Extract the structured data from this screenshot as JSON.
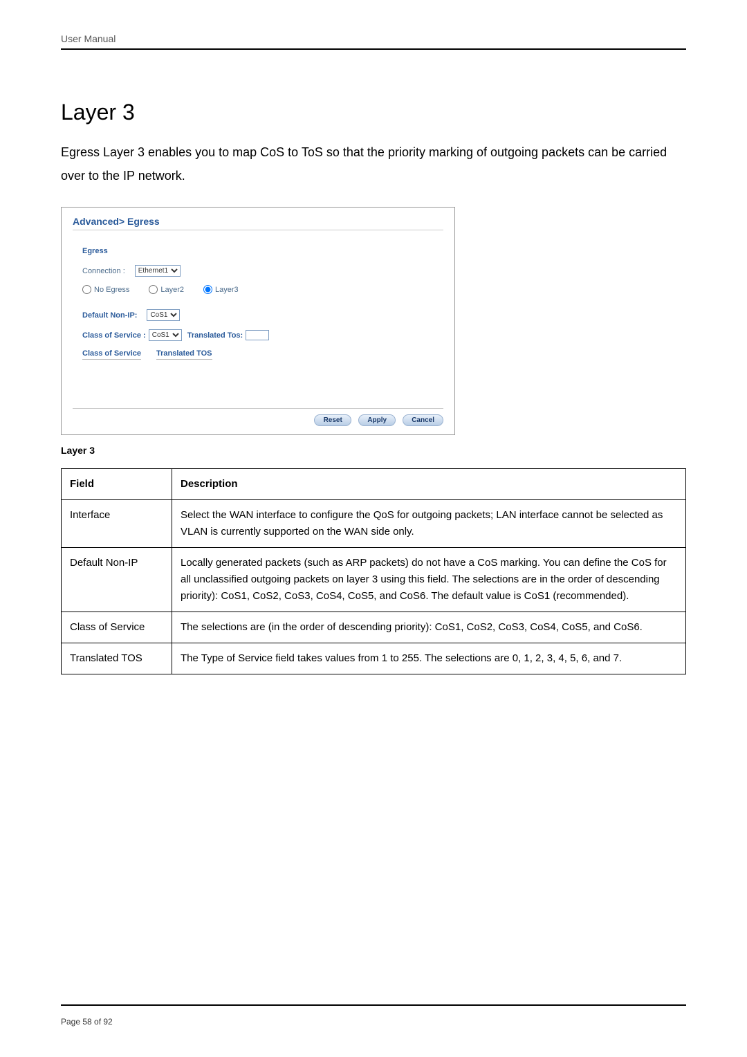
{
  "header_label": "User Manual",
  "section_title": "Layer 3",
  "intro_text": "Egress Layer 3 enables you to map CoS to ToS so that the priority marking of outgoing packets can be carried over to the IP network.",
  "screenshot": {
    "panel_title": "Advanced> Egress",
    "egress_label": "Egress",
    "connection_label": "Connection :",
    "connection_value": "Ethernet1",
    "radios": {
      "no_egress": "No Egress",
      "layer2": "Layer2",
      "layer3": "Layer3"
    },
    "default_nonip_label": "Default Non-IP:",
    "default_nonip_value": "CoS1",
    "cos_label": "Class of Service :",
    "cos_value": "CoS1",
    "translated_tos_label": "Translated Tos:",
    "th_cos": "Class of Service",
    "th_tos": "Translated TOS",
    "btn_reset": "Reset",
    "btn_apply": "Apply",
    "btn_cancel": "Cancel"
  },
  "caption": "Layer 3",
  "table": {
    "h_field": "Field",
    "h_desc": "Description",
    "rows": [
      {
        "field": "Interface",
        "desc": "Select the WAN interface to configure the QoS for outgoing packets; LAN interface cannot be selected as VLAN is currently supported on the WAN side only."
      },
      {
        "field": "Default Non-IP",
        "desc": "Locally generated packets (such as ARP packets) do not have a CoS marking. You can define the CoS for all unclassified outgoing packets on layer 3 using this field. The selections are in the order of descending priority): CoS1, CoS2, CoS3, CoS4, CoS5, and CoS6. The default value is CoS1 (recommended)."
      },
      {
        "field": "Class of Service",
        "desc": "The selections are (in the order of descending priority): CoS1, CoS2, CoS3, CoS4, CoS5, and CoS6."
      },
      {
        "field": "Translated TOS",
        "desc": "The Type of Service field takes values from 1 to 255. The selections are 0, 1, 2, 3, 4, 5, 6, and 7."
      }
    ]
  },
  "footer": "Page 58 of 92"
}
